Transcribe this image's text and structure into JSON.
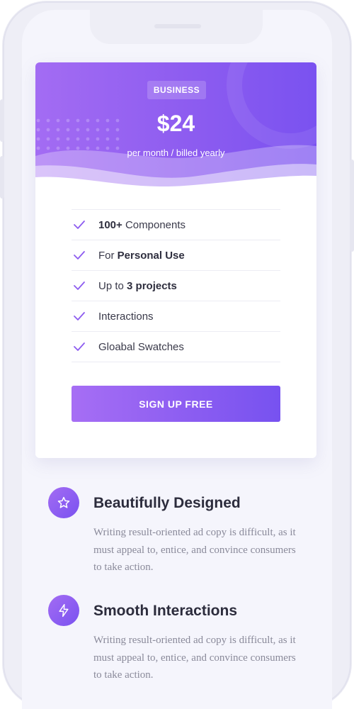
{
  "pricing": {
    "plan": "BUSINESS",
    "price": "$24",
    "billing": "per month / billed yearly",
    "accent_color": "#8d5cf0",
    "features": [
      {
        "bold": "100+",
        "text": " Components",
        "bold_first": true
      },
      {
        "text": "For ",
        "bold": "Personal Use",
        "bold_first": false
      },
      {
        "text": "Up to ",
        "bold": "3 projects",
        "bold_first": false
      },
      {
        "text": "Interactions",
        "bold": "",
        "bold_first": false
      },
      {
        "text": "Gloabal Swatches",
        "bold": "",
        "bold_first": false
      }
    ],
    "cta_label": "SIGN UP FREE"
  },
  "blocks": [
    {
      "icon": "star-icon",
      "title": "Beautifully Designed",
      "text": "Writing result-oriented ad copy is difficult, as it must appeal to, entice, and convince consumers to take action."
    },
    {
      "icon": "lightning-icon",
      "title": "Smooth Interactions",
      "text": "Writing result-oriented ad copy is difficult, as it must appeal to, entice, and convince consumers to take action."
    }
  ]
}
